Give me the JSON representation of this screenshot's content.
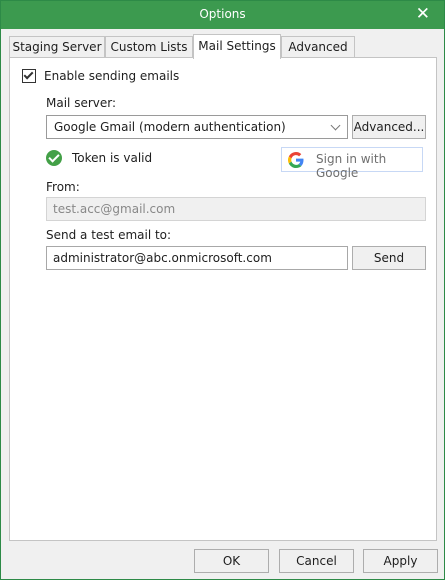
{
  "window": {
    "title": "Options",
    "close_glyph": "✕"
  },
  "tabs": [
    {
      "label": "Staging Server",
      "active": false
    },
    {
      "label": "Custom Lists",
      "active": false
    },
    {
      "label": "Mail Settings",
      "active": true
    },
    {
      "label": "Advanced",
      "active": false
    }
  ],
  "mail": {
    "enable_label": "Enable sending emails",
    "enable_checked": true,
    "server_label": "Mail server:",
    "server_value": "Google Gmail (modern authentication)",
    "advanced_button": "Advanced...",
    "token_status": "Token is valid",
    "google_button": "Sign in with Google",
    "from_label": "From:",
    "from_value": "test.acc@gmail.com",
    "test_label": "Send a test email to:",
    "test_value": "administrator@abc.onmicrosoft.com",
    "send_button": "Send"
  },
  "footer": {
    "ok": "OK",
    "cancel": "Cancel",
    "apply": "Apply"
  },
  "colors": {
    "titlebar": "#3c9a4f",
    "status_ok": "#43a047"
  },
  "icons": {
    "close": "close-icon",
    "check": "checkmark-icon",
    "token": "check-circle-icon",
    "google": "google-logo-icon",
    "dropdown": "chevron-down-icon"
  }
}
